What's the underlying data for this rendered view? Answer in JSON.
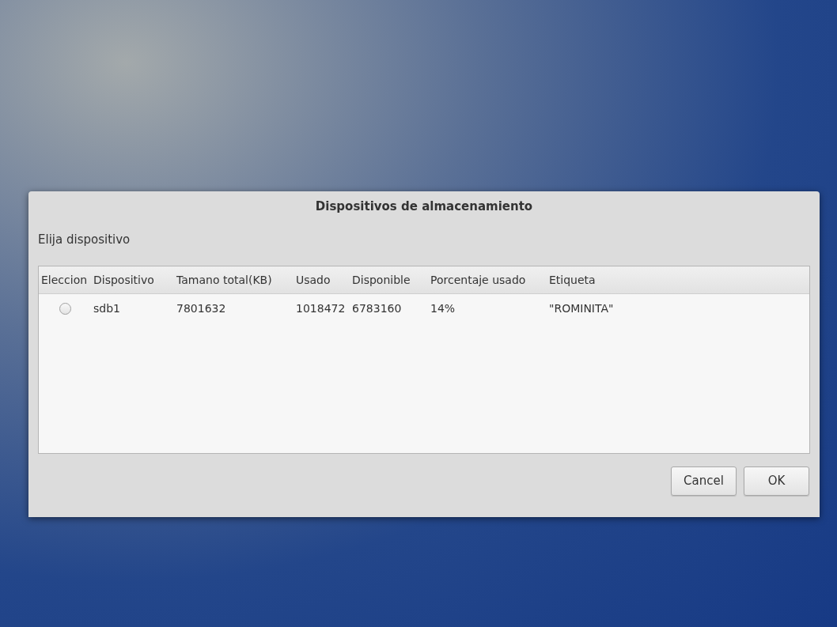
{
  "dialog": {
    "title": "Dispositivos de almacenamiento",
    "prompt": "Elija dispositivo"
  },
  "table": {
    "columns": [
      "Eleccion",
      "Dispositivo",
      "Tamano total(KB)",
      "Usado",
      "Disponible",
      "Porcentaje usado",
      "Etiqueta"
    ],
    "rows": [
      {
        "cells": [
          {
            "kind": "radio",
            "selected": false
          },
          {
            "kind": "text",
            "text": "sdb1"
          },
          {
            "kind": "text",
            "text": "7801632"
          },
          {
            "kind": "text",
            "text": "1018472"
          },
          {
            "kind": "text",
            "text": "6783160"
          },
          {
            "kind": "text",
            "text": "14%"
          },
          {
            "kind": "text",
            "text": "\"ROMINITA\""
          }
        ]
      }
    ]
  },
  "buttons": [
    "Cancel",
    "OK"
  ]
}
